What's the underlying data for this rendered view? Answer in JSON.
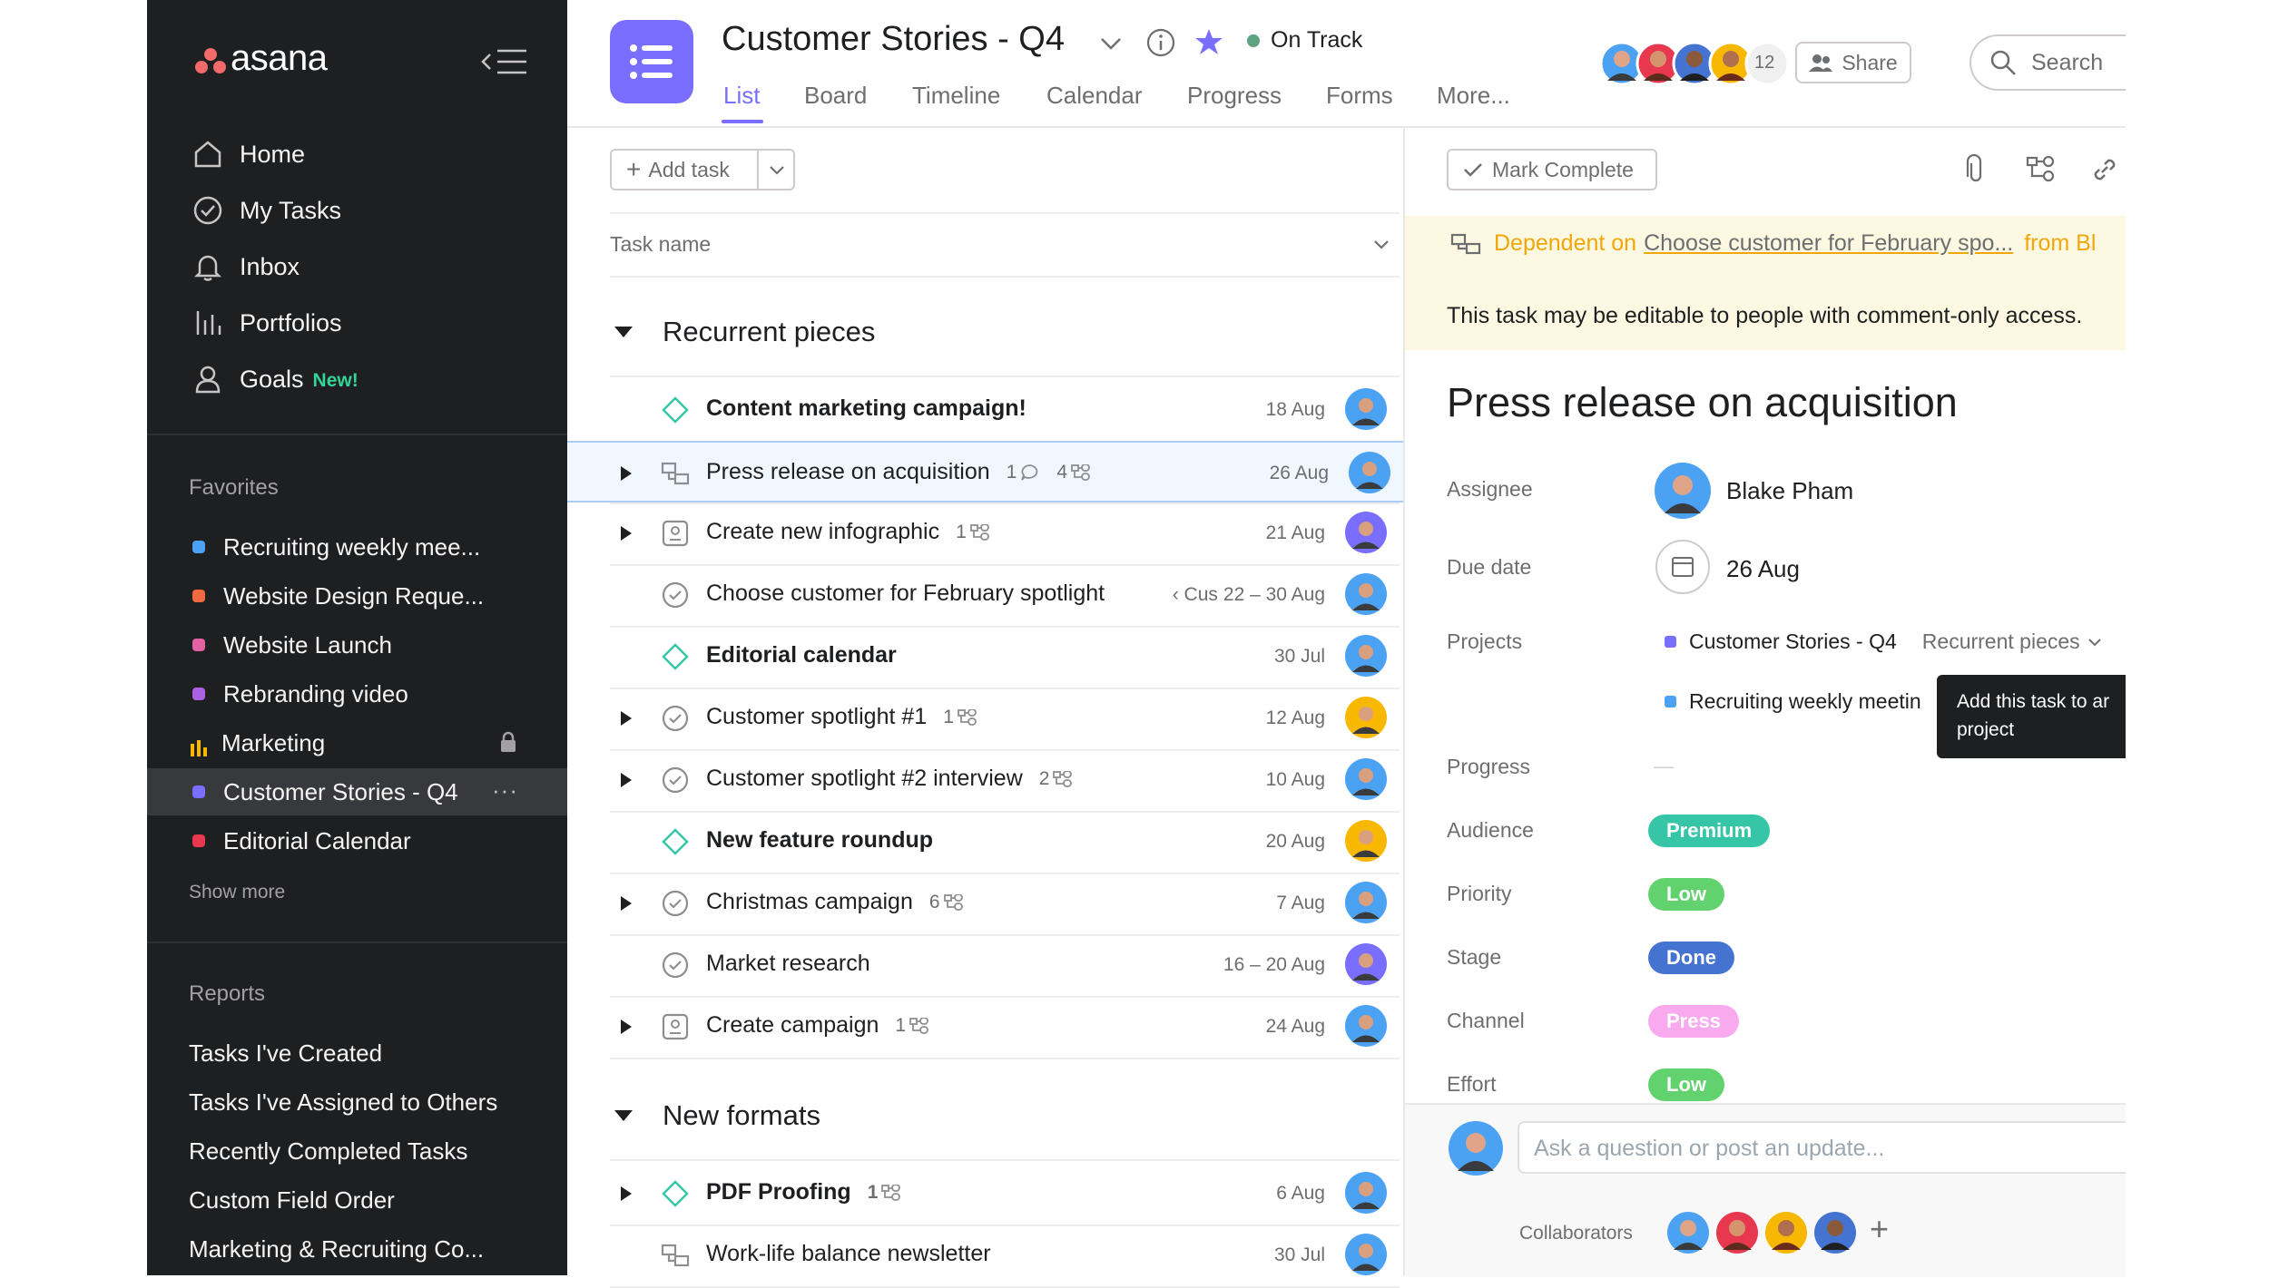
{
  "app": {
    "brand": "asana"
  },
  "sidebar": {
    "nav": [
      {
        "label": "Home",
        "icon": "home-icon"
      },
      {
        "label": "My Tasks",
        "icon": "check-circle-icon"
      },
      {
        "label": "Inbox",
        "icon": "bell-icon"
      },
      {
        "label": "Portfolios",
        "icon": "bar-chart-icon"
      },
      {
        "label": "Goals",
        "icon": "person-icon",
        "badge": "New!"
      }
    ],
    "favorites_heading": "Favorites",
    "favorites": [
      {
        "label": "Recruiting weekly mee...",
        "color": "#4ba1f2"
      },
      {
        "label": "Website Design Reque...",
        "color": "#f06a3f"
      },
      {
        "label": "Website Launch",
        "color": "#e362a4"
      },
      {
        "label": "Rebranding video",
        "color": "#aa62e3"
      },
      {
        "label": "Marketing",
        "color": "#f8b700"
      },
      {
        "label": "Customer Stories - Q4",
        "color": "#796eff"
      },
      {
        "label": "Editorial Calendar",
        "color": "#e8384f"
      }
    ],
    "show_more": "Show more",
    "reports_heading": "Reports",
    "reports": [
      "Tasks I've Created",
      "Tasks I've Assigned to Others",
      "Recently Completed Tasks",
      "Custom Field Order",
      "Marketing & Recruiting Co..."
    ]
  },
  "header": {
    "title": "Customer Stories - Q4",
    "status": "On Track",
    "tabs": [
      "List",
      "Board",
      "Timeline",
      "Calendar",
      "Progress",
      "Forms",
      "More..."
    ],
    "member_count": "12",
    "share_label": "Share",
    "search_placeholder": "Search"
  },
  "toolbar": {
    "add_task_label": "Add task",
    "column_task_name": "Task name"
  },
  "sections": [
    {
      "title": "Recurrent pieces",
      "tasks": [
        {
          "name": "Content  marketing campaign!",
          "date": "18 Aug",
          "bold": true,
          "icon": "milestone-icon",
          "expander": false
        },
        {
          "name": "Press release on acquisition",
          "comments": "1",
          "subtasks": "4",
          "date": "26 Aug",
          "icon": "dependency-icon",
          "expander": true,
          "selected": true
        },
        {
          "name": "Create new infographic",
          "subtasks": "1",
          "date": "21 Aug",
          "icon": "approval-icon",
          "expander": true
        },
        {
          "name": "Choose customer for February spotlight",
          "parent": "‹ Cus",
          "date": "22 – 30 Aug",
          "icon": "check-circle-icon",
          "expander": false
        },
        {
          "name": "Editorial calendar",
          "date": "30 Jul",
          "bold": true,
          "icon": "milestone-icon",
          "expander": false
        },
        {
          "name": "Customer spotlight #1",
          "subtasks": "1",
          "date": "12 Aug",
          "icon": "check-circle-icon",
          "expander": true
        },
        {
          "name": "Customer spotlight #2 interview",
          "subtasks": "2",
          "date": "10 Aug",
          "icon": "check-circle-icon",
          "expander": true
        },
        {
          "name": "New feature roundup",
          "date": "20 Aug",
          "bold": true,
          "icon": "milestone-icon",
          "expander": false
        },
        {
          "name": "Christmas campaign",
          "subtasks": "6",
          "date": "7 Aug",
          "icon": "check-circle-icon",
          "expander": true
        },
        {
          "name": "Market research",
          "date": "16 – 20 Aug",
          "icon": "check-circle-icon",
          "expander": false
        },
        {
          "name": "Create campaign",
          "subtasks": "1",
          "date": "24 Aug",
          "icon": "approval-icon",
          "expander": true
        }
      ]
    },
    {
      "title": "New formats",
      "tasks": [
        {
          "name": "PDF Proofing",
          "subtasks": "1",
          "date": "6 Aug",
          "bold": true,
          "icon": "milestone-icon",
          "expander": true
        },
        {
          "name": "Work-life balance newsletter",
          "date": "30 Jul",
          "icon": "dependency-icon",
          "expander": false
        }
      ]
    }
  ],
  "detail": {
    "mark_complete_label": "Mark Complete",
    "dependency_prefix": "Dependent on",
    "dependency_task": "Choose customer for February spo...",
    "dependency_suffix": "from Bl",
    "access_note": "This task may be editable to people with comment-only access.",
    "title": "Press release on acquisition",
    "assignee_label": "Assignee",
    "assignee": "Blake Pham",
    "due_label": "Due date",
    "due": "26 Aug",
    "projects_label": "Projects",
    "project_1": "Customer Stories - Q4",
    "project_1_section": "Recurrent pieces",
    "project_2": "Recruiting weekly meetin",
    "tooltip": "Add this task to an project",
    "tooltip_line1": "Add this task to ar",
    "tooltip_line2": "project",
    "progress_label": "Progress",
    "progress_value": "—",
    "fields": [
      {
        "label": "Audience",
        "value": "Premium",
        "color": "#37c5a7"
      },
      {
        "label": "Priority",
        "value": "Low",
        "color": "#62d26f"
      },
      {
        "label": "Stage",
        "value": "Done",
        "color": "#4573d2"
      },
      {
        "label": "Channel",
        "value": "Press",
        "color": "#f9aaef"
      },
      {
        "label": "Effort",
        "value": "Low",
        "color": "#62d26f"
      }
    ],
    "comment_placeholder": "Ask a question or post an update...",
    "collaborators_label": "Collaborators"
  }
}
